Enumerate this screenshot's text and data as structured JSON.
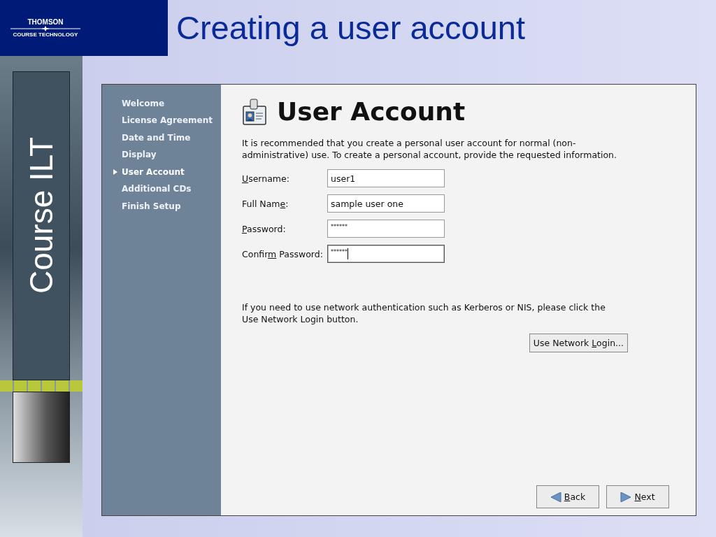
{
  "slide": {
    "logo": {
      "name": "THOMSON",
      "subtitle": "COURSE TECHNOLOGY"
    },
    "title": "Creating a user account",
    "side_caption": "Course ILT"
  },
  "window": {
    "sidebar": {
      "items": [
        {
          "label": "Welcome",
          "selected": false
        },
        {
          "label": "License Agreement",
          "selected": false
        },
        {
          "label": "Date and Time",
          "selected": false
        },
        {
          "label": "Display",
          "selected": false
        },
        {
          "label": "User Account",
          "selected": true
        },
        {
          "label": "Additional CDs",
          "selected": false
        },
        {
          "label": "Finish Setup",
          "selected": false
        }
      ]
    },
    "heading": "User Account",
    "intro": "It is recommended that you create a personal user account for normal (non-administrative) use.  To create a personal account, provide the requested information.",
    "fields": [
      {
        "label": [
          {
            "text": "U",
            "underlined": true
          },
          {
            "text": "sername:",
            "underlined": false
          }
        ],
        "value": "user1",
        "kind": "text",
        "focused": false
      },
      {
        "label": [
          {
            "text": "Full Nam",
            "underlined": false
          },
          {
            "text": "e",
            "underlined": true
          },
          {
            "text": ":",
            "underlined": false
          }
        ],
        "value": "sample user one",
        "kind": "text",
        "focused": false
      },
      {
        "label": [
          {
            "text": "P",
            "underlined": true
          },
          {
            "text": "assword:",
            "underlined": false
          }
        ],
        "value": "******",
        "kind": "password",
        "focused": false
      },
      {
        "label": [
          {
            "text": "Confir",
            "underlined": false
          },
          {
            "text": "m",
            "underlined": true
          },
          {
            "text": " Password:",
            "underlined": false
          }
        ],
        "value": "******",
        "kind": "password",
        "focused": true
      }
    ],
    "network_note": "If you need to use network authentication such as Kerberos or NIS, please click the Use Network Login button.",
    "network_button": {
      "label": [
        {
          "text": "Use Network ",
          "underlined": false
        },
        {
          "text": "L",
          "underlined": true
        },
        {
          "text": "ogin...",
          "underlined": false
        }
      ]
    },
    "nav_buttons": [
      {
        "label": [
          {
            "text": "B",
            "underlined": true
          },
          {
            "text": "ack",
            "underlined": false
          }
        ],
        "kind": "back"
      },
      {
        "label": [
          {
            "text": "N",
            "underlined": true
          },
          {
            "text": "ext",
            "underlined": false
          }
        ],
        "kind": "next"
      }
    ]
  }
}
